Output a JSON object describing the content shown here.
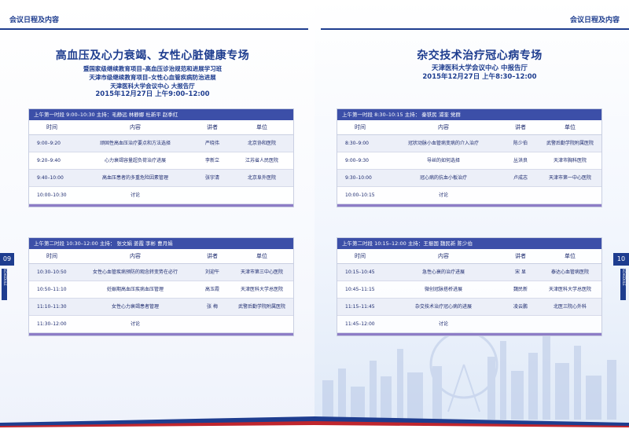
{
  "header_label": "会议日程及内容",
  "left": {
    "page_number": "09",
    "side_tab": "SCHEDULE",
    "title": "高血压及心力衰竭、女性心脏健康专场",
    "subtitle1": "暨国家级继续教育项目–高血压诊治规范和进展学习班",
    "subtitle2": "天津市级继续教育项目–女性心血管疾病防治进展",
    "venue": "天津医科大学会议中心  大报告厅",
    "datetime": "2015年12月27日  上午9:00–12:00",
    "sessions": [
      {
        "bar": "上午第一时段  9:00–10:30  主持：毛静远  林静娜  杜新平  赵季红",
        "headers": {
          "time": "时间",
          "content": "内容",
          "speaker": "讲者",
          "unit": "单位"
        },
        "rows": [
          {
            "time": "9:00–9:20",
            "content": "顽固性高血压治疗要点和方法选择",
            "speaker": "严晓伟",
            "unit": "北京协和医院"
          },
          {
            "time": "9:20–9:40",
            "content": "心力衰竭容量超负荷治疗进展",
            "speaker": "李新立",
            "unit": "江苏省人民医院"
          },
          {
            "time": "9:40–10:00",
            "content": "高血压患者的多重危险因素管理",
            "speaker": "张宇清",
            "unit": "北京阜外医院"
          },
          {
            "time": "10:00–10:30",
            "content": "讨论",
            "speaker": "",
            "unit": ""
          }
        ]
      },
      {
        "bar": "上午第二时段  10:30–12:00  主持：  张文娟  姜霞  李彬  曹月娟",
        "headers": {
          "time": "时间",
          "content": "内容",
          "speaker": "讲者",
          "unit": "单位"
        },
        "rows": [
          {
            "time": "10:30–10:50",
            "content": "女性心血管疾病预防的观念转变势在必行",
            "speaker": "刘迎午",
            "unit": "天津市第三中心医院"
          },
          {
            "time": "10:50–11:10",
            "content": "妊娠期高血压疾病血压管理",
            "speaker": "高玉霞",
            "unit": "天津医科大学总医院"
          },
          {
            "time": "11:10–11:30",
            "content": "女性心力衰竭患者管理",
            "speaker": "张  梅",
            "unit": "武警后勤学院附属医院"
          },
          {
            "time": "11:30–12:00",
            "content": "讨论",
            "speaker": "",
            "unit": ""
          }
        ]
      }
    ]
  },
  "right": {
    "page_number": "10",
    "side_tab": "SCHEDULE",
    "title": "杂交技术治疗冠心病专场",
    "subtitle1": "天津医科大学会议中心  中报告厅",
    "datetime": "2015年12月27日  上午8:30–12:00",
    "sessions": [
      {
        "bar": "上午第一时段  8:30–10:15  主持：  秦铁民  浦奎  党群",
        "headers": {
          "time": "时间",
          "content": "内容",
          "speaker": "讲者",
          "unit": "单位"
        },
        "rows": [
          {
            "time": "8:30–9:00",
            "content": "冠状动脉小血管病变病的介入治疗",
            "speaker": "陈少伯",
            "unit": "武警后勤学院附属医院"
          },
          {
            "time": "9:00–9:30",
            "content": "导丝的如何选择",
            "speaker": "丛洪良",
            "unit": "天津市胸科医院"
          },
          {
            "time": "9:30–10:00",
            "content": "冠心病的抗血小板治疗",
            "speaker": "卢成志",
            "unit": "天津市第一中心医院"
          },
          {
            "time": "10:00–10:15",
            "content": "讨论",
            "speaker": "",
            "unit": ""
          }
        ]
      },
      {
        "bar": "上午第二时段  10:15–12:00  主持：王振国  魏民新  陈少伯",
        "headers": {
          "time": "时间",
          "content": "内容",
          "speaker": "讲者",
          "unit": "单位"
        },
        "rows": [
          {
            "time": "10:15–10:45",
            "content": "急性心衰的治疗进展",
            "speaker": "宋  显",
            "unit": "泰达心血管病医院"
          },
          {
            "time": "10:45–11:15",
            "content": "微创冠脉搭桥进展",
            "speaker": "魏民新",
            "unit": "天津医科大学总医院"
          },
          {
            "time": "11:15–11:45",
            "content": "杂交技术治疗冠心病的进展",
            "speaker": "凌云鹏",
            "unit": "北医三院心外科"
          },
          {
            "time": "11:45–12:00",
            "content": "讨论",
            "speaker": "",
            "unit": ""
          }
        ]
      }
    ]
  },
  "colors": {
    "brand": "#1e3d8f",
    "bar": "#3c4fa8",
    "accent": "#8d7cc6",
    "footer_red": "#c0262d"
  }
}
